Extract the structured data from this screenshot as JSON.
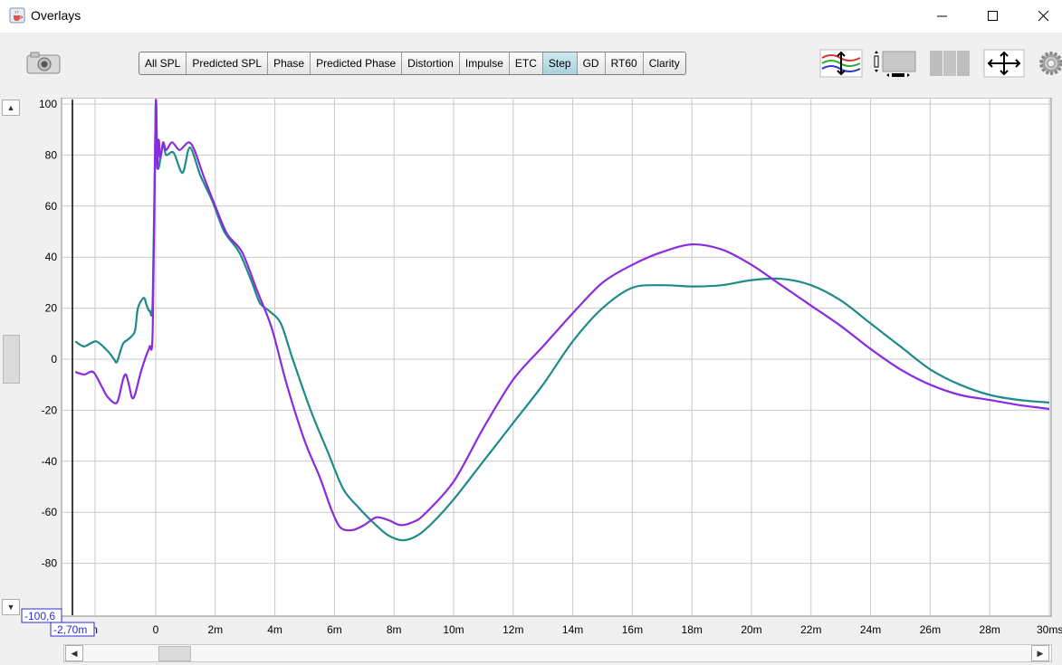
{
  "window": {
    "title": "Overlays",
    "app_icon": "java-cup-icon"
  },
  "window_controls": {
    "minimize_icon": "minimize-icon",
    "maximize_icon": "maximize-icon",
    "close_icon": "close-icon"
  },
  "toolbar": {
    "camera_icon": "camera-icon",
    "tabs": [
      "All SPL",
      "Predicted SPL",
      "Phase",
      "Predicted Phase",
      "Distortion",
      "Impulse",
      "ETC",
      "Step",
      "GD",
      "RT60",
      "Clarity"
    ],
    "active_tab": "Step",
    "right_icons": [
      "trace-arrange-icon",
      "graph-resize-icon",
      "graph-panels-icon",
      "fit-arrows-icon",
      "gear-icon"
    ]
  },
  "plot": {
    "y_unit": "%",
    "y_ticks": [
      "100",
      "80",
      "60",
      "40",
      "20",
      "0",
      "-20",
      "-40",
      "-60",
      "-80"
    ],
    "x_ticks": [
      "0",
      "2m",
      "4m",
      "6m",
      "8m",
      "10m",
      "12m",
      "14m",
      "16m",
      "18m",
      "20m",
      "22m",
      "24m",
      "26m",
      "28m",
      "30ms"
    ],
    "x_partial_tick": "m",
    "y_min_readout": "-100,6",
    "x_min_readout": "-2,70m"
  },
  "chart_data": {
    "type": "line",
    "xlabel": "",
    "ylabel": "%",
    "xlim": [
      -2.7,
      30
    ],
    "ylim": [
      -100.6,
      100
    ],
    "grid": true,
    "series": [
      {
        "color": "#1f8a8a",
        "points": [
          [
            -2.7,
            7
          ],
          [
            -2.4,
            5
          ],
          [
            -2.0,
            7
          ],
          [
            -1.6,
            3
          ],
          [
            -1.4,
            0
          ],
          [
            -1.3,
            -1
          ],
          [
            -1.1,
            6
          ],
          [
            -0.9,
            8
          ],
          [
            -0.7,
            11
          ],
          [
            -0.6,
            20
          ],
          [
            -0.4,
            24
          ],
          [
            -0.3,
            21
          ],
          [
            -0.2,
            19
          ],
          [
            -0.1,
            24
          ],
          [
            0,
            100
          ],
          [
            0.05,
            78
          ],
          [
            0.1,
            75
          ],
          [
            0.25,
            84
          ],
          [
            0.35,
            80
          ],
          [
            0.6,
            81
          ],
          [
            0.9,
            73
          ],
          [
            1.15,
            83
          ],
          [
            1.5,
            72
          ],
          [
            1.9,
            62
          ],
          [
            2.3,
            50
          ],
          [
            2.8,
            42
          ],
          [
            3.2,
            31
          ],
          [
            3.5,
            22
          ],
          [
            3.8,
            19
          ],
          [
            4.2,
            14
          ],
          [
            4.6,
            0
          ],
          [
            5.2,
            -20
          ],
          [
            5.8,
            -37
          ],
          [
            6.3,
            -51
          ],
          [
            6.8,
            -58
          ],
          [
            7.3,
            -64
          ],
          [
            7.8,
            -69
          ],
          [
            8.3,
            -71
          ],
          [
            8.8,
            -69
          ],
          [
            9.3,
            -64
          ],
          [
            10,
            -55
          ],
          [
            11,
            -40
          ],
          [
            12,
            -25
          ],
          [
            13,
            -10
          ],
          [
            14,
            7
          ],
          [
            15,
            20
          ],
          [
            16,
            28
          ],
          [
            17,
            29
          ],
          [
            18,
            28.5
          ],
          [
            19,
            29
          ],
          [
            20,
            31
          ],
          [
            21,
            31.5
          ],
          [
            22,
            29
          ],
          [
            23,
            23
          ],
          [
            24,
            14
          ],
          [
            25,
            5
          ],
          [
            26,
            -4
          ],
          [
            27,
            -10
          ],
          [
            28,
            -14
          ],
          [
            29,
            -16
          ],
          [
            30,
            -17
          ]
        ]
      },
      {
        "color": "#8a2be2",
        "points": [
          [
            -2.7,
            -5
          ],
          [
            -2.4,
            -6
          ],
          [
            -2.1,
            -5
          ],
          [
            -1.8,
            -11
          ],
          [
            -1.6,
            -15
          ],
          [
            -1.3,
            -17
          ],
          [
            -1.1,
            -8
          ],
          [
            -1.0,
            -6
          ],
          [
            -0.9,
            -10
          ],
          [
            -0.8,
            -15
          ],
          [
            -0.7,
            -14
          ],
          [
            -0.5,
            -5
          ],
          [
            -0.3,
            2
          ],
          [
            -0.2,
            5
          ],
          [
            -0.1,
            12
          ],
          [
            0,
            100
          ],
          [
            0.05,
            75
          ],
          [
            0.1,
            86
          ],
          [
            0.15,
            79
          ],
          [
            0.25,
            85
          ],
          [
            0.35,
            82
          ],
          [
            0.55,
            85
          ],
          [
            0.8,
            82
          ],
          [
            1.1,
            85
          ],
          [
            1.3,
            82
          ],
          [
            1.6,
            72
          ],
          [
            2.0,
            60
          ],
          [
            2.4,
            49
          ],
          [
            2.9,
            42
          ],
          [
            3.4,
            27
          ],
          [
            3.9,
            12
          ],
          [
            4.4,
            -10
          ],
          [
            5.0,
            -32
          ],
          [
            5.5,
            -46
          ],
          [
            5.9,
            -59
          ],
          [
            6.2,
            -66
          ],
          [
            6.6,
            -67
          ],
          [
            7.0,
            -65
          ],
          [
            7.4,
            -62
          ],
          [
            7.8,
            -63
          ],
          [
            8.2,
            -65
          ],
          [
            8.6,
            -64
          ],
          [
            9.0,
            -61
          ],
          [
            10,
            -48
          ],
          [
            11,
            -27
          ],
          [
            12,
            -8
          ],
          [
            13,
            5
          ],
          [
            14,
            18
          ],
          [
            15,
            30
          ],
          [
            16,
            37
          ],
          [
            17,
            42
          ],
          [
            18,
            45
          ],
          [
            19,
            43
          ],
          [
            20,
            37
          ],
          [
            21,
            29
          ],
          [
            22,
            21
          ],
          [
            23,
            13
          ],
          [
            24,
            4
          ],
          [
            25,
            -4
          ],
          [
            26,
            -10
          ],
          [
            27,
            -14
          ],
          [
            28,
            -16
          ],
          [
            29,
            -18
          ],
          [
            30,
            -19.5
          ]
        ]
      }
    ]
  },
  "colors": {
    "grid": "#c8c8c8",
    "plot_bg": "#ffffff",
    "active_tab": "#a9d2dc"
  }
}
